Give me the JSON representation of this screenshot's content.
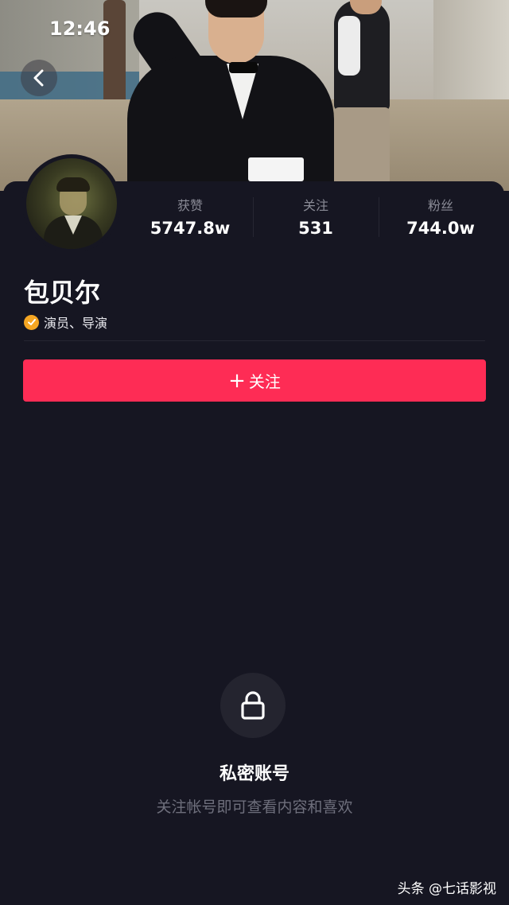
{
  "status_bar": {
    "time": "12:46"
  },
  "profile": {
    "name": "包贝尔",
    "verified_label": "演员、导演",
    "stats": [
      {
        "label": "获赞",
        "value": "5747.8w"
      },
      {
        "label": "关注",
        "value": "531"
      },
      {
        "label": "粉丝",
        "value": "744.0w"
      }
    ],
    "follow_button": {
      "plus": "+",
      "label": "关注"
    }
  },
  "private_notice": {
    "icon": "lock-icon",
    "title": "私密账号",
    "description": "关注帐号即可查看内容和喜欢"
  },
  "watermark": "头条 @七话影视",
  "colors": {
    "background": "#161622",
    "accent": "#fe2c55",
    "verified": "#f5a623",
    "muted_text": "#8a8b96"
  }
}
